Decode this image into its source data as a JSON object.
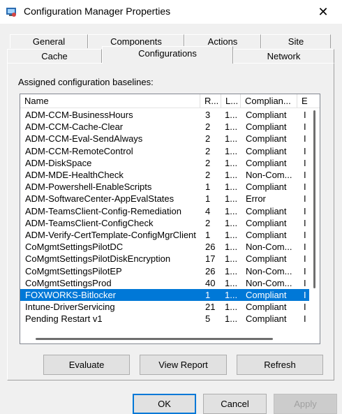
{
  "window": {
    "title": "Configuration Manager Properties",
    "close_glyph": "✕"
  },
  "tabs_back": [
    "General",
    "Components",
    "Actions",
    "Site"
  ],
  "tabs_front": [
    "Cache",
    "Configurations",
    "Network"
  ],
  "active_tab": "Configurations",
  "panel": {
    "label": "Assigned configuration baselines:"
  },
  "table": {
    "columns": [
      "Name",
      "R...",
      "L...",
      "Complian...",
      "E"
    ],
    "rows": [
      [
        "ADM-CCM-BusinessHours",
        "3",
        "1...",
        "Compliant",
        "I"
      ],
      [
        "ADM-CCM-Cache-Clear",
        "2",
        "1...",
        "Compliant",
        "I"
      ],
      [
        "ADM-CCM-Eval-SendAlways",
        "2",
        "1...",
        "Compliant",
        "I"
      ],
      [
        "ADM-CCM-RemoteControl",
        "2",
        "1...",
        "Compliant",
        "I"
      ],
      [
        "ADM-DiskSpace",
        "2",
        "1...",
        "Compliant",
        "I"
      ],
      [
        "ADM-MDE-HealthCheck",
        "2",
        "1...",
        "Non-Com...",
        "I"
      ],
      [
        "ADM-Powershell-EnableScripts",
        "1",
        "1...",
        "Compliant",
        "I"
      ],
      [
        "ADM-SoftwareCenter-AppEvalStates",
        "1",
        "1...",
        "Error",
        "I"
      ],
      [
        "ADM-TeamsClient-Config-Remediation",
        "4",
        "1...",
        "Compliant",
        "I"
      ],
      [
        "ADM-TeamsClient-ConfigCheck",
        "2",
        "1...",
        "Compliant",
        "I"
      ],
      [
        "ADM-Verify-CertTemplate-ConfigMgrClient",
        "1",
        "1...",
        "Compliant",
        "I"
      ],
      [
        "CoMgmtSettingsPilotDC",
        "26",
        "1...",
        "Non-Com...",
        "I"
      ],
      [
        "CoMgmtSettingsPilotDiskEncryption",
        "17",
        "1...",
        "Compliant",
        "I"
      ],
      [
        "CoMgmtSettingsPilotEP",
        "26",
        "1...",
        "Non-Com...",
        "I"
      ],
      [
        "CoMgmtSettingsProd",
        "40",
        "1...",
        "Non-Com...",
        "I"
      ],
      [
        "FOXWORKS-Bitlocker",
        "1",
        "1...",
        "Compliant",
        "I"
      ],
      [
        "Intune-DriverServicing",
        "21",
        "1...",
        "Compliant",
        "I"
      ],
      [
        "Pending Restart v1",
        "5",
        "1...",
        "Compliant",
        "I"
      ]
    ],
    "selected_index": 15
  },
  "panel_buttons": {
    "evaluate": "Evaluate",
    "view_report": "View Report",
    "refresh": "Refresh"
  },
  "dialog_buttons": {
    "ok": "OK",
    "cancel": "Cancel",
    "apply": "Apply"
  },
  "colors": {
    "selection": "#0078d7",
    "window_bg": "#f0f0f0",
    "default_button_border": "#0078d7"
  }
}
